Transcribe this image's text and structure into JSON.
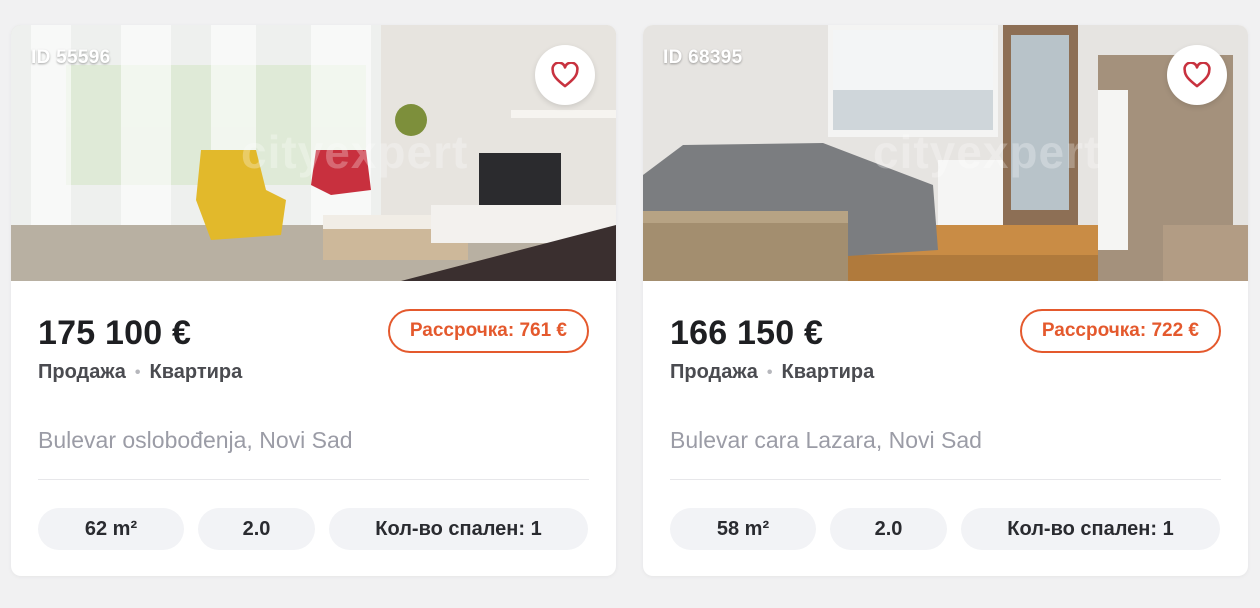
{
  "listings": [
    {
      "id_label": "ID 55596",
      "price": "175 100 €",
      "installment": "Рассрочка: 761 €",
      "deal_type": "Продажа",
      "property_type": "Квартира",
      "address": "Bulevar oslobođenja, Novi Sad",
      "area": "62 m²",
      "rooms": "2.0",
      "bedrooms": "Кол-во спален: 1",
      "favorite_icon": "heart-icon"
    },
    {
      "id_label": "ID 68395",
      "price": "166 150 €",
      "installment": "Рассрочка: 722 €",
      "deal_type": "Продажа",
      "property_type": "Квартира",
      "address": "Bulevar cara Lazara, Novi Sad",
      "area": "58 m²",
      "rooms": "2.0",
      "bedrooms": "Кол-во спален: 1",
      "favorite_icon": "heart-icon"
    }
  ],
  "watermark": "cityexpert",
  "colors": {
    "accent": "#e4592d",
    "heart": "#c8323f",
    "text_primary": "#1e1f22",
    "text_muted": "#9b9ca6",
    "chip_bg": "#f2f3f6"
  }
}
